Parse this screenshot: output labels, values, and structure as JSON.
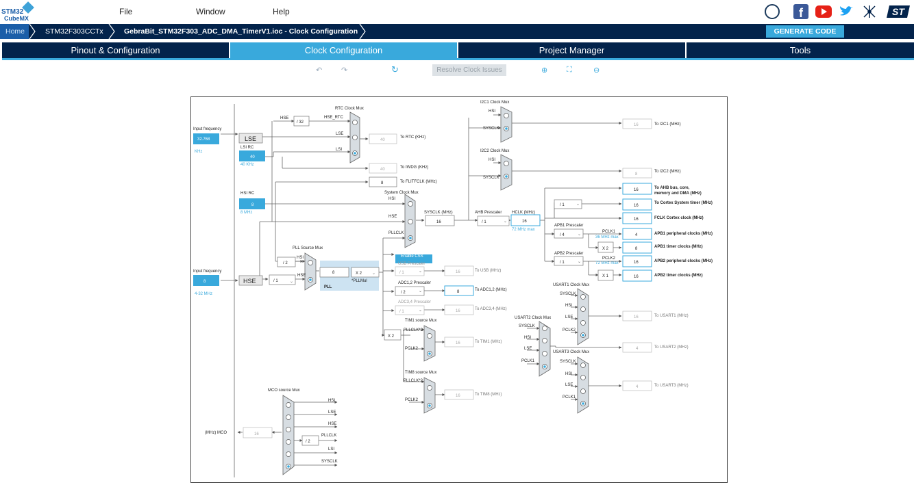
{
  "app": {
    "logo_line1": "STM32",
    "logo_line2": "CubeMX"
  },
  "menu": {
    "file": "File",
    "window": "Window",
    "help": "Help"
  },
  "breadcrumb": {
    "home": "Home",
    "device": "STM32F303CCTx",
    "project": "GebraBit_STM32F303_ADC_DMA_TimerV1.ioc - Clock Configuration"
  },
  "actions": {
    "generate_code": "GENERATE CODE",
    "resolve_clock_issues": "Resolve Clock Issues"
  },
  "tabs": {
    "pinout": "Pinout & Configuration",
    "clock": "Clock Configuration",
    "project": "Project Manager",
    "tools": "Tools"
  },
  "colors": {
    "accent": "#39a9dc",
    "navy": "#03234b"
  },
  "clock": {
    "input_freq_label": "Input frequency",
    "lse_value": "32.768",
    "lse_unit": "KHz",
    "lse": "LSE",
    "lsi_rc": "LSI RC",
    "lsi_value": "40",
    "lsi_unit": "40 KHz",
    "hsi_rc": "HSI RC",
    "hsi_value": "8",
    "hsi_unit": "8 MHz",
    "hse_value": "8",
    "hse_range": "4-32 MHz",
    "hse": "HSE",
    "rtc_mux": "RTC Clock Mux",
    "hse_div": "/ 32",
    "hse_rtc": "HSE_RTC",
    "rtc_lse": "LSE",
    "rtc_lsi": "LSI",
    "rtc_value": "40",
    "rtc_label": "To RTC (KHz)",
    "iwdg_value": "40",
    "iwdg_label": "To IWDG (KHz)",
    "flit_value": "8",
    "flit_label": "To FLITFCLK (MHz)",
    "sys_mux": "System Clock Mux",
    "sys_hsi": "HSI",
    "sys_hse": "HSE",
    "sys_pll": "PLLCLK",
    "enable_css": "Enable CSS",
    "sysclk_label": "SYSCLK (MHz)",
    "sysclk_value": "16",
    "ahb_prescaler": "AHB Prescaler",
    "ahb_div": "/ 1",
    "hclk_label": "HCLK (MHz)",
    "hclk_value": "16",
    "hclk_max": "72 MHz max",
    "pll_src_mux": "PLL Source Mux",
    "pll_hsi": "HSI",
    "pll_hse": "HSE",
    "pll_hsi_div": "/ 2",
    "pll_hse_div": "/ 1",
    "pll_in": "8",
    "pll_mul": "X 2",
    "pll_mul_label": "*PLLMul",
    "pll": "PLL",
    "i2c1_mux": "I2C1 Clock Mux",
    "i2c1_hsi": "HSI",
    "i2c1_sys": "SYSCLK",
    "i2c1_value": "16",
    "i2c1_label": "To I2C1 (MHz)",
    "i2c2_mux": "I2C2 Clock Mux",
    "i2c2_hsi": "HSI",
    "i2c2_sys": "SYSCLK",
    "i2c2_value": "8",
    "i2c2_label": "To I2C2 (MHz)",
    "ahb_bus_value": "16",
    "ahb_bus_label1": "To AHB bus, core,",
    "ahb_bus_label2": "memory and DMA (MHz)",
    "cortex_div": "/ 1",
    "cortex_value": "16",
    "cortex_label": "To Cortex System timer (MHz)",
    "fclk_value": "16",
    "fclk_label": "FCLK Cortex clock (MHz)",
    "apb1_prescaler": "APB1 Prescaler",
    "apb1_div": "/ 4",
    "pclk1": "PCLK1",
    "pclk1_max": "36 MHz max",
    "apb1_periph_value": "4",
    "apb1_periph_label": "APB1 peripheral clocks (MHz)",
    "apb1_x": "X 2",
    "apb1_timer_value": "8",
    "apb1_timer_label": "APB1 timer clocks (MHz)",
    "apb2_prescaler": "APB2 Prescaler",
    "apb2_div": "/ 1",
    "pclk2": "PCLK2",
    "pclk2_max": "72 MHz max",
    "apb2_periph_value": "16",
    "apb2_periph_label": "APB2 peripheral clocks (MHz)",
    "apb2_x": "X 1",
    "apb2_timer_value": "16",
    "apb2_timer_label": "APB2 timer clocks (MHz)",
    "usb_prescaler": "USB Prescaler",
    "usb_div": "/ 1",
    "usb_value": "16",
    "usb_label": "To USB (MHz)",
    "adc12_prescaler": "ADC1,2 Prescaler",
    "adc12_div": "/ 2",
    "adc12_value": "8",
    "adc12_label": "To ADC1,2 (MHz)",
    "adc34_prescaler": "ADC3,4 Prescaler",
    "adc34_div": "/ 1",
    "adc34_value": "16",
    "adc34_label": "To ADC3,4 (MHz)",
    "tim_x": "X 2",
    "tim1_mux": "TIM1 source Mux",
    "tim1_pll": "PLLCLK*2",
    "tim1_pclk": "PCLK2",
    "tim1_value": "16",
    "tim1_label": "To TIM1 (MHz)",
    "tim8_mux": "TIM8 source Mux",
    "tim8_pll": "PLLCLK*2",
    "tim8_pclk": "PCLK2",
    "tim8_value": "16",
    "tim8_label": "To TIM8 (MHz)",
    "usart1_mux": "USART1 Clock Mux",
    "usart1_sys": "SYSCLK",
    "usart1_hsi": "HSI",
    "usart1_lse": "LSE",
    "usart1_pclk": "PCLK2",
    "usart1_value": "16",
    "usart1_label": "To USART1 (MHz)",
    "usart2_mux": "USART2 Clock Mux",
    "usart2_sys": "SYSCLK",
    "usart2_hsi": "HSI",
    "usart2_lse": "LSE",
    "usart2_pclk": "PCLK1",
    "usart2_value": "4",
    "usart2_label": "To USART2 (MHz)",
    "usart3_mux": "USART3 Clock Mux",
    "usart3_sys": "SYSCLK",
    "usart3_hsi": "HSI",
    "usart3_lse": "LSE",
    "usart3_pclk": "PCLK1",
    "usart3_value": "4",
    "usart3_label": "To USART3 (MHz)",
    "mco_mux": "MCO source Mux",
    "mco_hsi": "HSI",
    "mco_lse": "LSE",
    "mco_hse": "HSE",
    "mco_pll": "PLLCLK",
    "mco_pll_div": "/ 2",
    "mco_lsi": "LSI",
    "mco_sys": "SYSCLK",
    "mco_label": "(MHz) MCO",
    "mco_value": "16"
  }
}
